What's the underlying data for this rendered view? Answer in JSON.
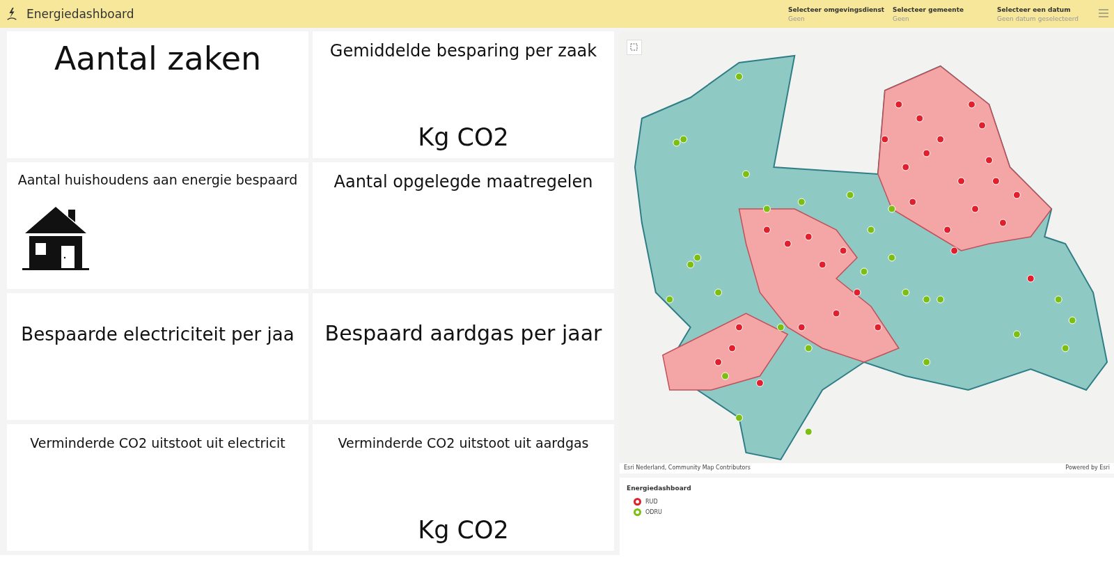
{
  "header": {
    "title": "Energiedashboard",
    "selectors": [
      {
        "label": "Selecteer omgevingsdienst",
        "value": "Geen"
      },
      {
        "label": "Selecteer gemeente",
        "value": "Geen"
      },
      {
        "label": "Selecteer een datum",
        "value": "Geen datum geselecteerd"
      }
    ]
  },
  "cards": [
    {
      "title": "Aantal zaken",
      "kind": "big"
    },
    {
      "title": "Gemiddelde besparing per zaak",
      "unit": "Kg CO2",
      "kind": "medium"
    },
    {
      "title": "Aantal huishoudens aan energie bespaard",
      "kind": "house"
    },
    {
      "title": "Aantal opgelegde maatregelen",
      "kind": "medium"
    },
    {
      "title": "Bespaarde electriciteit per jaa",
      "kind": "mid-low"
    },
    {
      "title": "Bespaard aardgas per jaar",
      "kind": "large"
    },
    {
      "title": "Verminderde CO2 uitstoot uit electricit",
      "kind": "small"
    },
    {
      "title": "Verminderde CO2 uitstoot uit aardgas",
      "unit": "Kg CO2",
      "kind": "small"
    }
  ],
  "map": {
    "attribution": "Esri Nederland, Community Map Contributors",
    "powered_by": "Powered by Esri"
  },
  "legend": {
    "title": "Energiedashboard",
    "items": [
      {
        "label": "RUD",
        "color": "#e0202e"
      },
      {
        "label": "ODRU",
        "color": "#7cbf12"
      }
    ]
  }
}
